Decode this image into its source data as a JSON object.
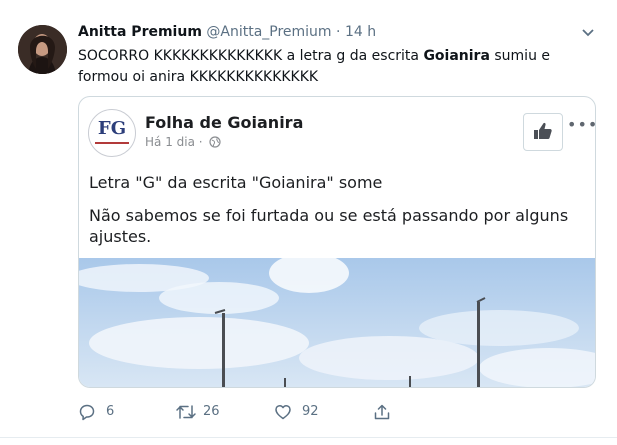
{
  "tweet": {
    "display_name": "Anitta Premium",
    "handle": "@Anitta_Premium",
    "separator": "·",
    "timestamp": "14 h",
    "text_before": "SOCORRO KKKKKKKKKKKKKK a letra g da escrita ",
    "text_bold": "Goianira",
    "text_after": " sumiu e formou oi anira KKKKKKKKKKKKKK"
  },
  "embedded_post": {
    "logo_text": "FG",
    "page_name": "Folha de Goianira",
    "posted": "Há 1 dia ·",
    "paragraph_1": "Letra \"G\" da escrita \"Goianira\" some",
    "paragraph_2": "Não sabemos se foi furtada ou se está passando por alguns ajustes.",
    "more_label": "•••"
  },
  "actions": {
    "replies": "6",
    "retweets": "26",
    "likes": "92"
  },
  "colors": {
    "secondary_text": "#5b7083",
    "border": "#cfd9de",
    "sky": "#b9d4ee"
  }
}
